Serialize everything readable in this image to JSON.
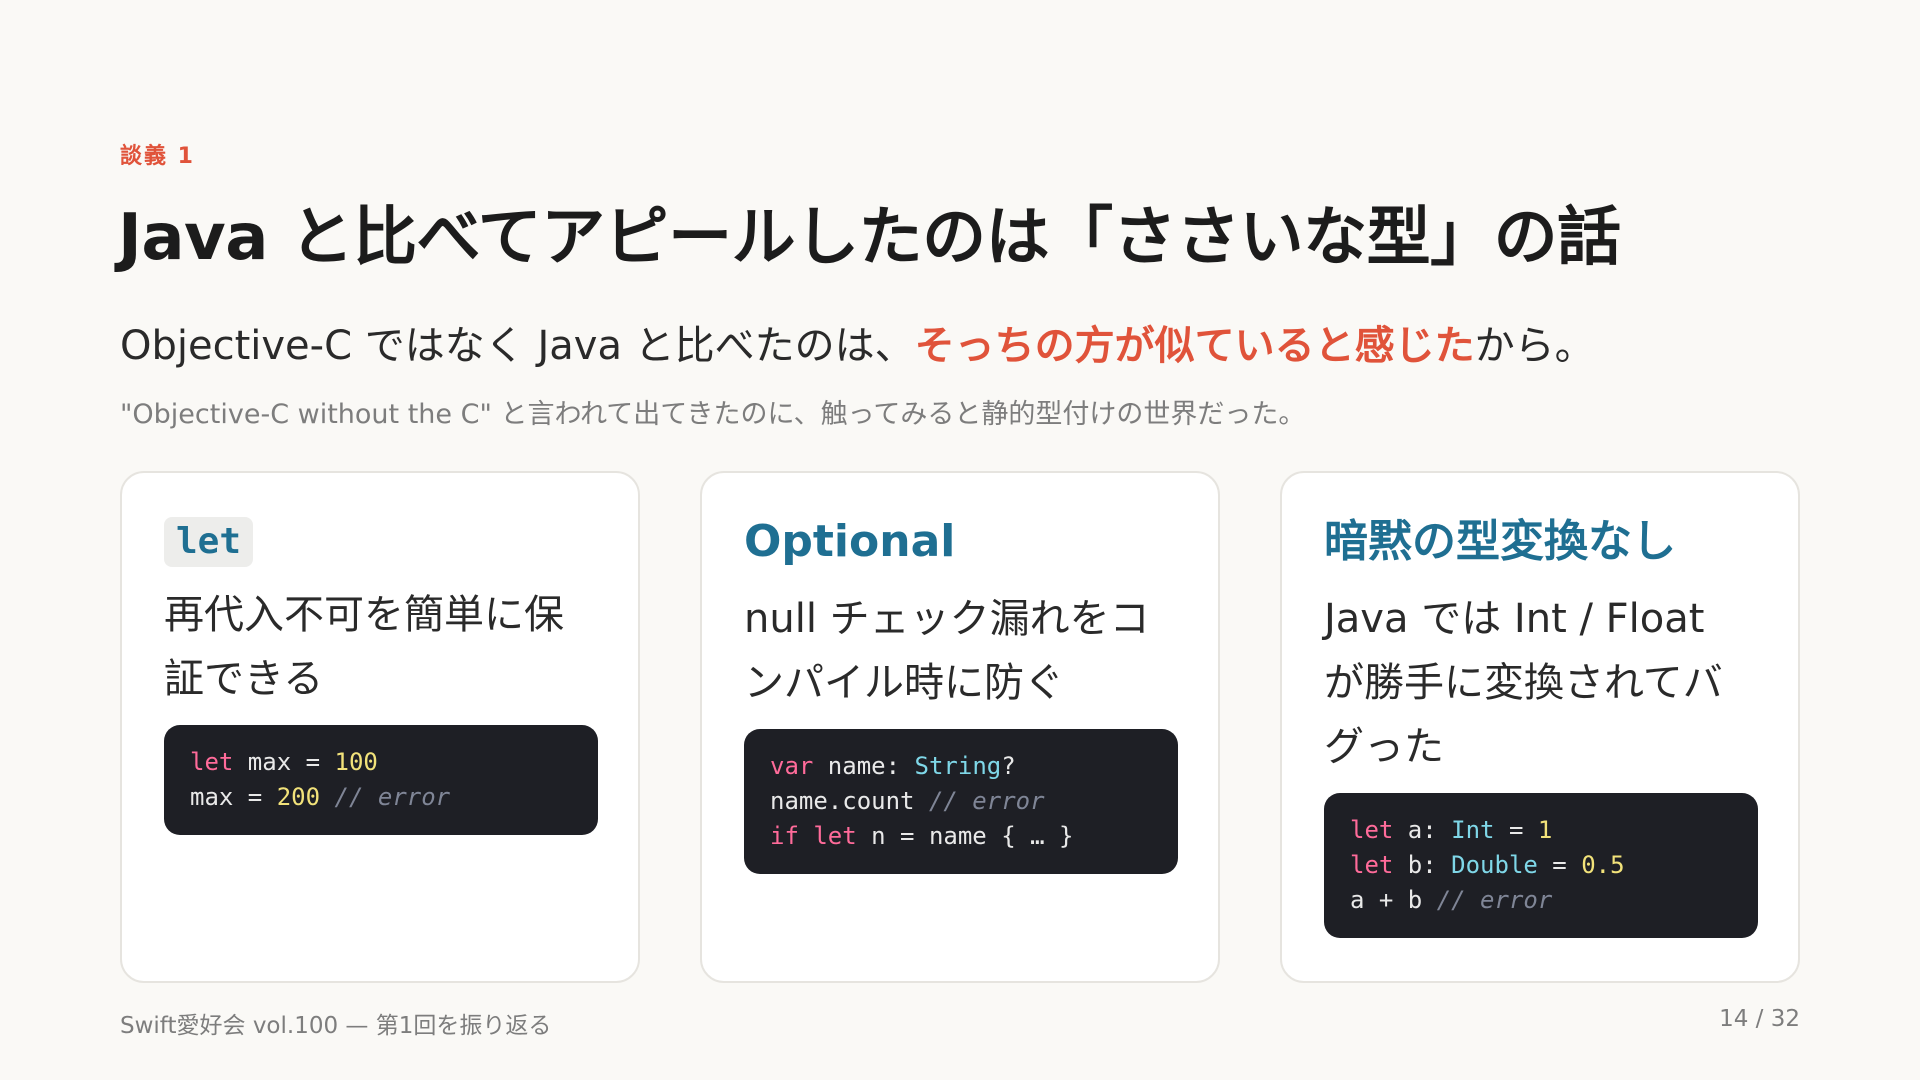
{
  "slide": {
    "eyebrow": "談義 1",
    "title": "Java と比べてアピールしたのは「ささいな型」の話",
    "lead_before": "Objective-C ではなく Java と比べたのは、",
    "lead_highlight": "そっちの方が似ていると感じた",
    "lead_after": "から。",
    "sub": "\"Objective-C without the C\" と言われて出てきたのに、触ってみると静的型付けの世界だった。"
  },
  "cards": [
    {
      "heading": "let",
      "heading_is_code": true,
      "body": "再代入不可を簡単に保証できる",
      "code": [
        [
          {
            "t": "kw",
            "v": "let"
          },
          {
            "t": "pl",
            "v": " max = "
          },
          {
            "t": "num",
            "v": "100"
          }
        ],
        [
          {
            "t": "pl",
            "v": "max = "
          },
          {
            "t": "num",
            "v": "200"
          },
          {
            "t": "pl",
            "v": " "
          },
          {
            "t": "cm",
            "v": "// error"
          }
        ]
      ]
    },
    {
      "heading": "Optional",
      "heading_is_code": false,
      "body": "null チェック漏れをコンパイル時に防ぐ",
      "code": [
        [
          {
            "t": "kw",
            "v": "var"
          },
          {
            "t": "pl",
            "v": " name: "
          },
          {
            "t": "type",
            "v": "String"
          },
          {
            "t": "pl",
            "v": "?"
          }
        ],
        [
          {
            "t": "pl",
            "v": "name.count "
          },
          {
            "t": "cm",
            "v": "// error"
          }
        ],
        [
          {
            "t": "kw",
            "v": "if let"
          },
          {
            "t": "pl",
            "v": " n = name { … }"
          }
        ]
      ]
    },
    {
      "heading": "暗黙の型変換なし",
      "heading_is_code": false,
      "body": "Java では Int / Float が勝手に変換されてバグった",
      "code": [
        [
          {
            "t": "kw",
            "v": "let"
          },
          {
            "t": "pl",
            "v": " a: "
          },
          {
            "t": "type",
            "v": "Int"
          },
          {
            "t": "pl",
            "v": " = "
          },
          {
            "t": "num",
            "v": "1"
          }
        ],
        [
          {
            "t": "kw",
            "v": "let"
          },
          {
            "t": "pl",
            "v": " b: "
          },
          {
            "t": "type",
            "v": "Double"
          },
          {
            "t": "pl",
            "v": " = "
          },
          {
            "t": "num",
            "v": "0.5"
          }
        ],
        [
          {
            "t": "pl",
            "v": "a + b "
          },
          {
            "t": "cm",
            "v": "// error"
          }
        ]
      ]
    }
  ],
  "footer": {
    "left": "Swift愛好会 vol.100 — 第1回を振り返る",
    "page": "14 / 32"
  },
  "colors": {
    "accent": "#e0533a",
    "heading": "#1f6f92",
    "code_bg": "#1e1f25",
    "keyword": "#ff6b9a",
    "type": "#7fd7e8",
    "number": "#f2e27a",
    "comment": "#7f8596"
  }
}
